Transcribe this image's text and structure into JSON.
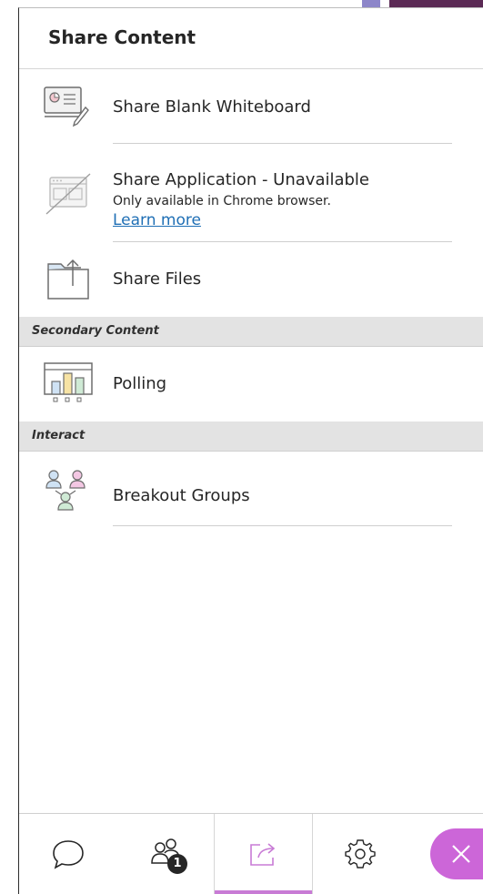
{
  "panel": {
    "title": "Share Content"
  },
  "share_items": [
    {
      "label": "Share Blank Whiteboard",
      "icon": "whiteboard-icon"
    },
    {
      "label": "Share Application - Unavailable",
      "sub": "Only available in Chrome browser.",
      "link": "Learn more",
      "icon": "application-unavailable-icon"
    },
    {
      "label": "Share Files",
      "icon": "share-files-icon"
    }
  ],
  "sections": {
    "secondary": {
      "label": "Secondary Content"
    },
    "interact": {
      "label": "Interact"
    }
  },
  "secondary_items": [
    {
      "label": "Polling",
      "icon": "polling-icon"
    }
  ],
  "interact_items": [
    {
      "label": "Breakout Groups",
      "icon": "breakout-groups-icon"
    }
  ],
  "bottom_tabs": [
    {
      "name": "chat",
      "icon": "chat-icon"
    },
    {
      "name": "attendees",
      "icon": "attendees-icon",
      "badge": "1"
    },
    {
      "name": "share-content",
      "icon": "share-icon",
      "active": true
    },
    {
      "name": "settings",
      "icon": "gear-icon"
    },
    {
      "name": "close",
      "icon": "close-icon"
    }
  ],
  "colors": {
    "accent": "#cc66d8",
    "active_underline": "#c87bd5",
    "link": "#1f6fb5",
    "section_bg": "#e3e3e3"
  }
}
